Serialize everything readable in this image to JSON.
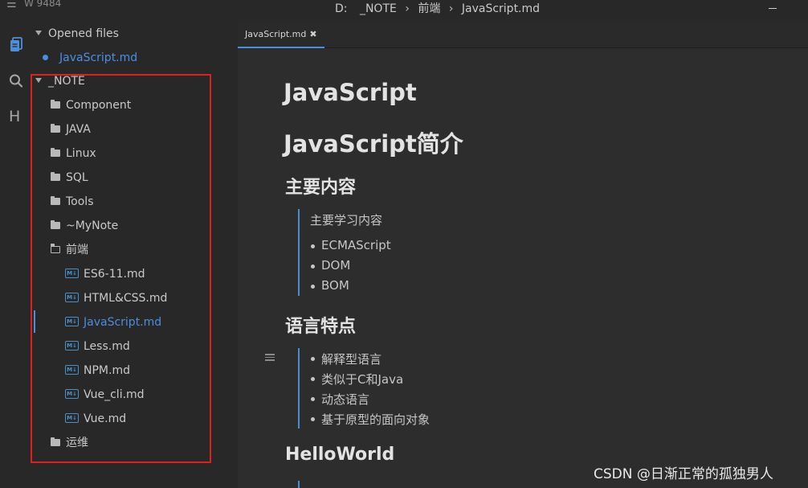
{
  "window": {
    "sidebar_title": "W 9484",
    "breadcrumb": [
      "D:",
      "_NOTE",
      "前端",
      "JavaScript.md"
    ]
  },
  "activity_bar": {
    "icons": [
      "menu-icon",
      "files-icon",
      "search-icon",
      "outline-icon"
    ],
    "menu_glyph": "☰",
    "outline_glyph": "H"
  },
  "sidebar": {
    "opened_files_label": "Opened files",
    "opened_files": [
      "JavaScript.md"
    ],
    "root_folder": "_NOTE",
    "folders": [
      "Component",
      "JAVA",
      "Linux",
      "SQL",
      "Tools",
      "~MyNote"
    ],
    "open_folder": "前端",
    "files": [
      "ES6-11.md",
      "HTML&CSS.md",
      "JavaScript.md",
      "Less.md",
      "NPM.md",
      "Vue_cli.md",
      "Vue.md"
    ],
    "selected_file": "JavaScript.md",
    "last_folder": "运维",
    "md_badge": "M↓"
  },
  "tabs": [
    {
      "label": "JavaScript.md",
      "close": "✖"
    }
  ],
  "document": {
    "h1_1": "JavaScript",
    "h1_2": "JavaScript简介",
    "sec1_title": "主要内容",
    "sec1_quote": "主要学习内容",
    "sec1_items": [
      "ECMAScript",
      "DOM",
      "BOM"
    ],
    "sec2_title": "语言特点",
    "sec2_items": [
      "解释型语言",
      "类似于C和Java",
      "动态语言",
      "基于原型的面向对象"
    ],
    "sec3_title": "HelloWorld"
  },
  "watermark": "CSDN @日渐正常的孤独男人",
  "colors": {
    "accent": "#4b8ee0",
    "highlight_box": "#e02020"
  }
}
